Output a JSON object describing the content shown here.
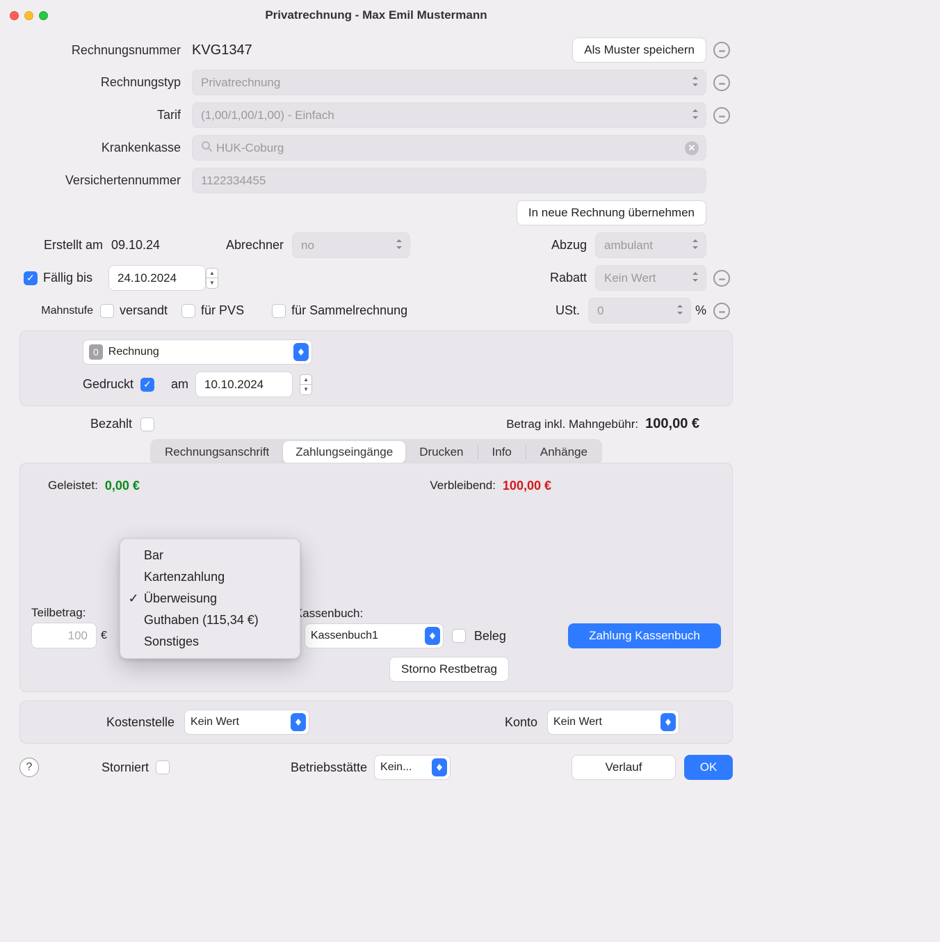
{
  "window": {
    "title": "Privatrechnung - Max Emil Mustermann"
  },
  "labels": {
    "rechnungsnummer": "Rechnungsnummer",
    "rechnungstyp": "Rechnungstyp",
    "tarif": "Tarif",
    "krankenkasse": "Krankenkasse",
    "versichertennummer": "Versichertennummer",
    "erstellt_am": "Erstellt am",
    "abrechner": "Abrechner",
    "abzug": "Abzug",
    "faellig_bis": "Fällig bis",
    "rabatt": "Rabatt",
    "mahnstufe": "Mahnstufe",
    "versandt": "versandt",
    "fuer_pvs": "für PVS",
    "fuer_sammel": "für Sammelrechnung",
    "ust": "USt.",
    "gedruckt": "Gedruckt",
    "am": "am",
    "bezahlt": "Bezahlt",
    "betrag_inkl": "Betrag inkl. Mahngebühr:",
    "geleistet": "Geleistet:",
    "verbleibend": "Verbleibend:",
    "teilbetrag": "Teilbetrag:",
    "kassenbuch": "Kassenbuch:",
    "beleg": "Beleg",
    "kostenstelle": "Kostenstelle",
    "konto": "Konto",
    "storniert": "Storniert",
    "betriebsstaette": "Betriebsstätte",
    "percent": "%"
  },
  "values": {
    "rechnungsnummer": "KVG1347",
    "rechnungstyp": "Privatrechnung",
    "tarif": "(1,00/1,00/1,00) - Einfach",
    "krankenkasse": "HUK-Coburg",
    "versichertennummer": "1122334455",
    "erstellt_am": "09.10.24",
    "abrechner": "no",
    "abzug": "ambulant",
    "faellig_bis": "24.10.2024",
    "rabatt": "Kein Wert",
    "ust": "0",
    "rechnung_badge": "0",
    "rechnung_label": "Rechnung",
    "gedruckt_am": "10.10.2024",
    "betrag": "100,00 €",
    "geleistet": "0,00 €",
    "verbleibend": "100,00 €",
    "teilbetrag": "100",
    "teilbetrag_unit": "€",
    "kassenbuch": "Kassenbuch1",
    "kostenstelle": "Kein Wert",
    "konto": "Kein Wert",
    "betriebsstaette": "Kein..."
  },
  "buttons": {
    "als_muster": "Als Muster speichern",
    "in_neue": "In neue Rechnung übernehmen",
    "zahlung_kb": "Zahlung Kassenbuch",
    "storno": "Storno Restbetrag",
    "verlauf": "Verlauf",
    "ok": "OK",
    "help": "?"
  },
  "tabs": {
    "anschrift": "Rechnungsanschrift",
    "zahlung": "Zahlungseingänge",
    "drucken": "Drucken",
    "info": "Info",
    "anhaenge": "Anhänge"
  },
  "menu": {
    "bar": "Bar",
    "karte": "Kartenzahlung",
    "ueberweisung": "Überweisung",
    "guthaben": "Guthaben (115,34 €)",
    "sonstiges": "Sonstiges",
    "check": "✓"
  }
}
